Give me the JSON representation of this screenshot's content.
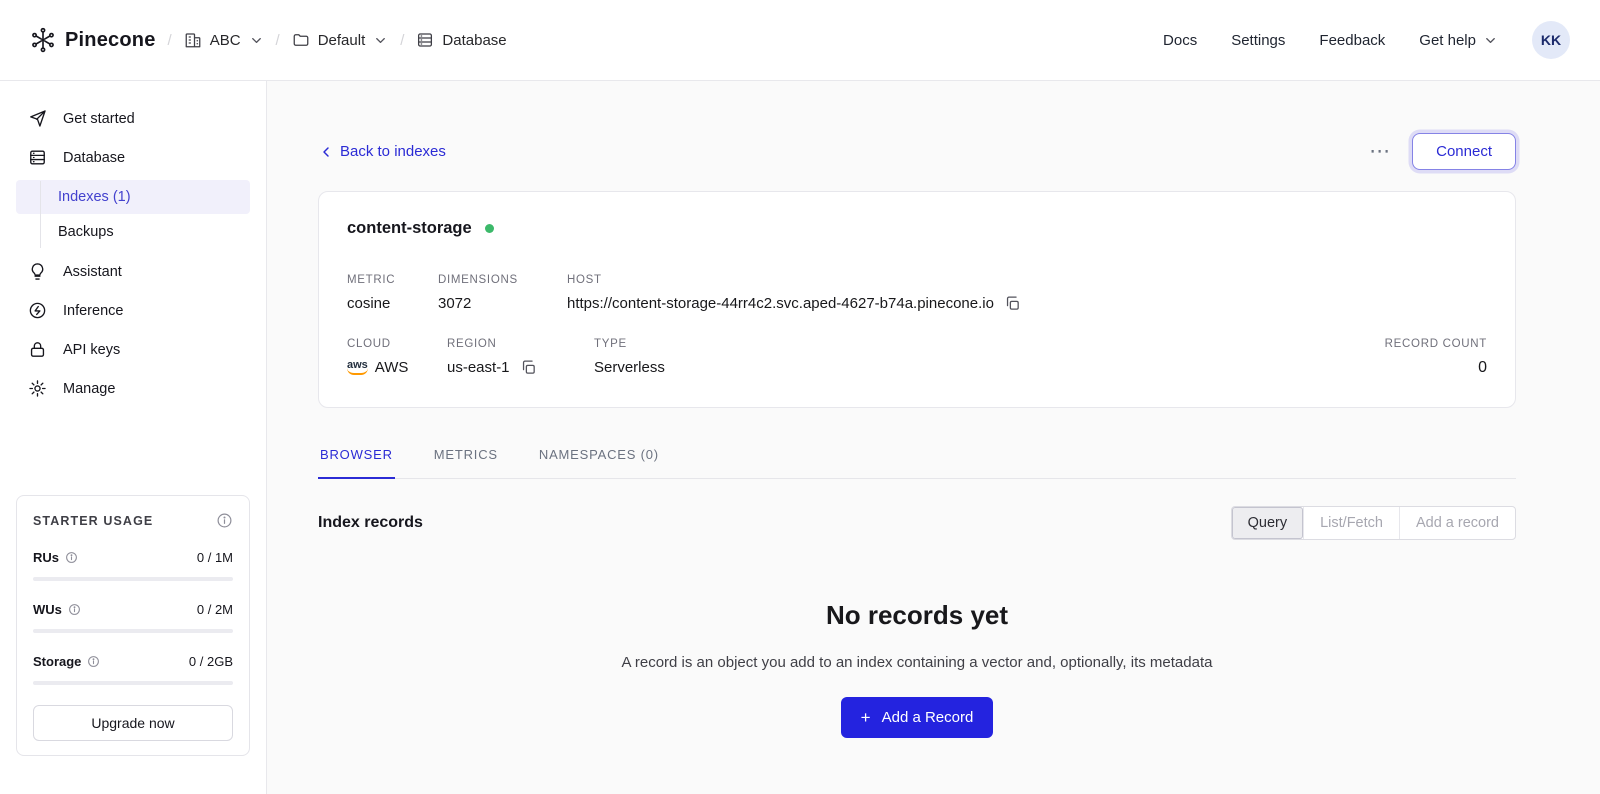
{
  "colors": {
    "accent_blue": "#2b2bd5",
    "primary_button_blue": "#2423df",
    "selected_sidebar_bg": "#f1f0fb",
    "status_green": "#3cb96a",
    "aws_orange": "#ff9900"
  },
  "navbar": {
    "brand": "Pinecone",
    "separator": "/",
    "org": "ABC",
    "project": "Default",
    "section": "Database",
    "links": [
      "Docs",
      "Settings",
      "Feedback"
    ],
    "get_help": "Get help",
    "avatar_initials": "KK"
  },
  "sidebar": {
    "items": [
      {
        "label": "Get started"
      },
      {
        "label": "Database"
      },
      {
        "label": "Indexes (1)"
      },
      {
        "label": "Backups"
      },
      {
        "label": "Assistant"
      },
      {
        "label": "Inference"
      },
      {
        "label": "API keys"
      },
      {
        "label": "Manage"
      }
    ],
    "usage": {
      "title": "STARTER USAGE",
      "rows": [
        {
          "label": "RUs",
          "value": "0 / 1M"
        },
        {
          "label": "WUs",
          "value": "0 / 2M"
        },
        {
          "label": "Storage",
          "value": "0 / 2GB"
        }
      ],
      "upgrade_label": "Upgrade now"
    }
  },
  "main": {
    "back_link": "Back to indexes",
    "more_icon": "⋯",
    "connect_label": "Connect",
    "index_card": {
      "name": "content-storage",
      "metric_label": "METRIC",
      "metric": "cosine",
      "dimensions_label": "DIMENSIONS",
      "dimensions": "3072",
      "host_label": "HOST",
      "host": "https://content-storage-44rr4c2.svc.aped-4627-b74a.pinecone.io",
      "cloud_label": "CLOUD",
      "aws_logo": "aws",
      "cloud": "AWS",
      "region_label": "REGION",
      "region": "us-east-1",
      "type_label": "TYPE",
      "type": "Serverless",
      "record_count_label": "RECORD COUNT",
      "record_count": "0"
    },
    "tabs": [
      {
        "label": "BROWSER"
      },
      {
        "label": "METRICS"
      },
      {
        "label": "NAMESPACES (0)"
      }
    ],
    "records": {
      "heading": "Index records",
      "segments": [
        "Query",
        "List/Fetch",
        "Add a record"
      ],
      "empty_title": "No records yet",
      "empty_description": "A record is an object you add to an index containing a vector and, optionally, its metadata",
      "add_icon": "+",
      "add_button": "Add a Record"
    }
  }
}
